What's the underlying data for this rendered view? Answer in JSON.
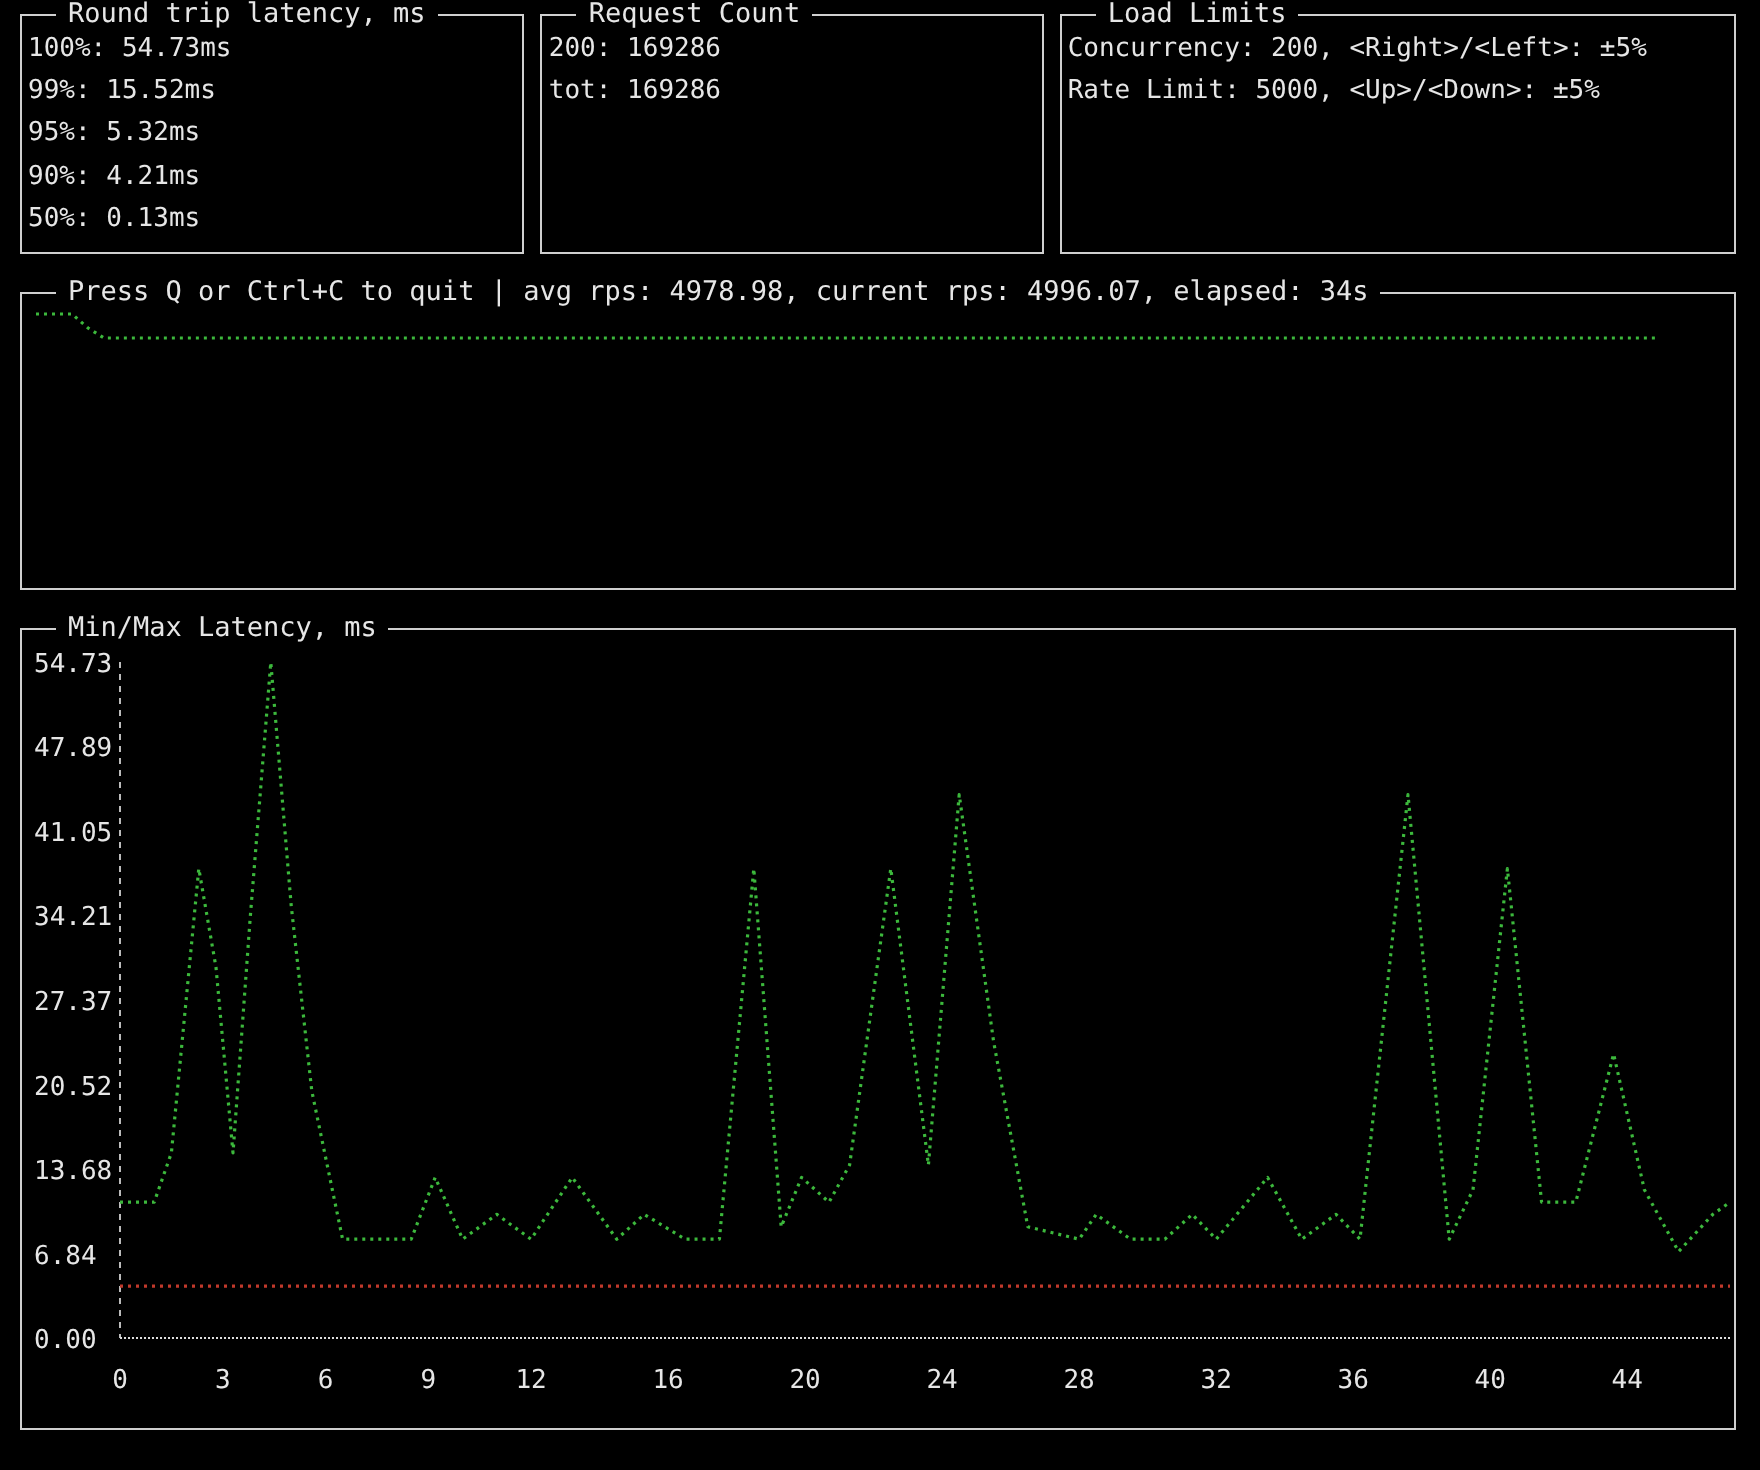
{
  "panels": [
    {
      "title": "Round trip latency, ms",
      "lines": [
        "100%: 54.73ms",
        "99%: 15.52ms",
        "95%: 5.32ms",
        "90%: 4.21ms",
        "50%: 0.13ms"
      ]
    },
    {
      "title": "Request Count",
      "lines": [
        "200: 169286",
        "tot: 169286"
      ]
    },
    {
      "title": "Load Limits",
      "lines": [
        "Concurrency: 200, <Right>/<Left>: ±5%",
        "Rate Limit: 5000, <Up>/<Down>: ±5%"
      ]
    }
  ],
  "rps_panel": {
    "title": "Press Q or Ctrl+C to quit | avg rps: 4978.98, current rps: 4996.07, elapsed: 34s"
  },
  "latency_chart": {
    "title": "Min/Max Latency, ms",
    "chart_data": {
      "type": "line",
      "x": [
        0,
        1,
        1.5,
        2.3,
        2.8,
        3.3,
        3.8,
        4.4,
        5,
        5.6,
        6.5,
        8.5,
        9.2,
        10,
        11,
        12,
        13.2,
        14.5,
        15.3,
        16.5,
        17.5,
        18.5,
        19.3,
        19.9,
        20.7,
        21.3,
        22.5,
        23.6,
        24.5,
        25.5,
        26.5,
        28,
        28.5,
        29.5,
        30.5,
        31.3,
        32,
        33.5,
        34.5,
        35.5,
        36.2,
        37.6,
        38.8,
        39.5,
        40.5,
        41.5,
        42.5,
        43.6,
        44.5,
        45.5,
        46.5,
        47
      ],
      "series": [
        {
          "color": "#3cb83c",
          "line_style": "dotted",
          "values": [
            11,
            11,
            15,
            38,
            30,
            15,
            34,
            54.7,
            35,
            20,
            8,
            8,
            13,
            8,
            10,
            8,
            13,
            8,
            10,
            8,
            8,
            38,
            9,
            13,
            11,
            14,
            38,
            14,
            44,
            24,
            9,
            8,
            10,
            8,
            8,
            10,
            8,
            13,
            8,
            10,
            8,
            44,
            8,
            12,
            38,
            11,
            11,
            23,
            12,
            7,
            10,
            11
          ]
        },
        {
          "color": "#c0392b",
          "line_style": "dotted",
          "values": [
            4.2,
            4.2,
            4.2,
            4.2,
            4.2,
            4.2,
            4.2,
            4.2,
            4.2,
            4.2,
            4.2,
            4.2,
            4.2,
            4.2,
            4.2,
            4.2,
            4.2,
            4.2,
            4.2,
            4.2,
            4.2,
            4.2,
            4.2,
            4.2,
            4.2,
            4.2,
            4.2,
            4.2,
            4.2,
            4.2,
            4.2,
            4.2,
            4.2,
            4.2,
            4.2,
            4.2,
            4.2,
            4.2,
            4.2,
            4.2,
            4.2,
            4.2,
            4.2,
            4.2,
            4.2,
            4.2,
            4.2,
            4.2,
            4.2,
            4.2,
            4.2,
            4.2
          ]
        }
      ],
      "xlim": [
        0,
        47
      ],
      "ylim": [
        0,
        54.73
      ],
      "xticks": [
        0,
        3,
        6,
        9,
        12,
        16,
        20,
        24,
        28,
        32,
        36,
        40,
        44
      ],
      "yticks": [
        {
          "value": 0,
          "label": "0.00"
        },
        {
          "value": 6.84,
          "label": "6.84"
        },
        {
          "value": 13.68,
          "label": "13.68"
        },
        {
          "value": 20.52,
          "label": "20.52"
        },
        {
          "value": 27.37,
          "label": "27.37"
        },
        {
          "value": 34.21,
          "label": "34.21"
        },
        {
          "value": 41.05,
          "label": "41.05"
        },
        {
          "value": 47.89,
          "label": "47.89"
        },
        {
          "value": 54.73,
          "label": "54.73"
        }
      ]
    }
  }
}
